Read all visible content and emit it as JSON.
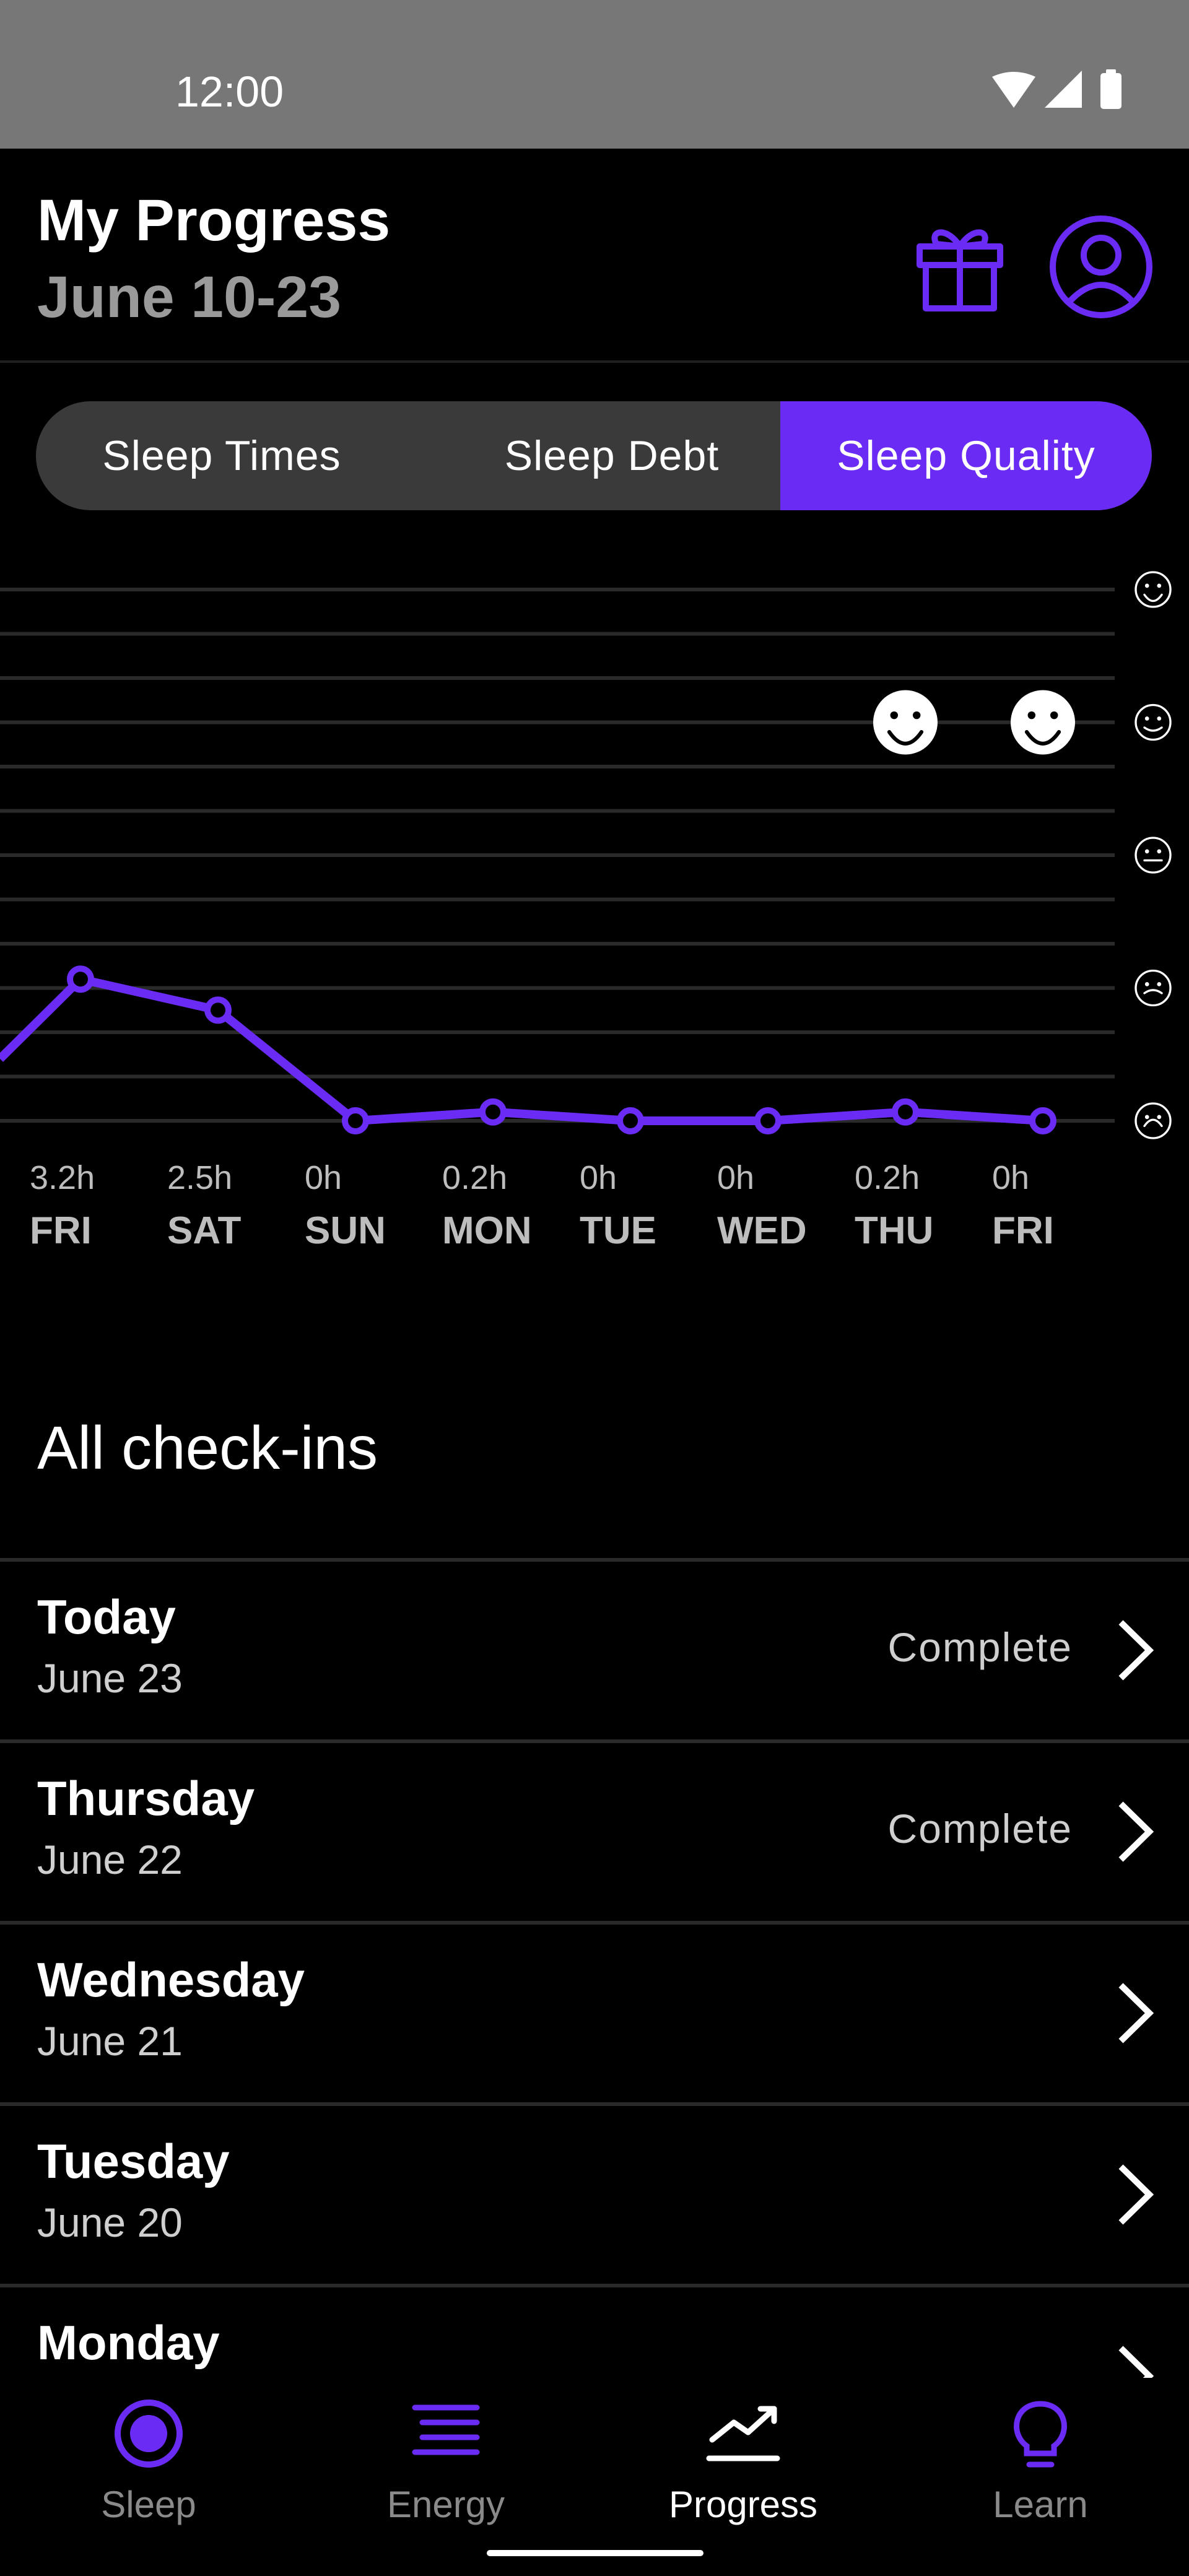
{
  "status": {
    "time": "12:00"
  },
  "header": {
    "title": "My Progress",
    "subtitle": "June 10-23"
  },
  "tabs": [
    {
      "label": "Sleep Times",
      "active": false
    },
    {
      "label": "Sleep Debt",
      "active": false
    },
    {
      "label": "Sleep Quality",
      "active": true
    }
  ],
  "chart_data": {
    "type": "line",
    "categories": [
      "FRI",
      "SAT",
      "SUN",
      "MON",
      "TUE",
      "WED",
      "THU",
      "FRI"
    ],
    "value_labels": [
      "3.2h",
      "2.5h",
      "0h",
      "0.2h",
      "0h",
      "0h",
      "0.2h",
      "0h"
    ],
    "values": [
      3.2,
      2.5,
      0,
      0.2,
      0,
      0,
      0.2,
      0
    ],
    "quality_checkins": [
      {
        "category_index": 6,
        "level": 4
      },
      {
        "category_index": 7,
        "level": 4
      }
    ],
    "quality_levels": [
      "very-unhappy",
      "unhappy",
      "neutral",
      "happy",
      "very-happy"
    ],
    "ylim": [
      0,
      12
    ],
    "grid": true,
    "line_color": "#6a2cf4"
  },
  "checkins": {
    "title": "All check-ins",
    "items": [
      {
        "day": "Today",
        "date": "June 23",
        "status": "Complete"
      },
      {
        "day": "Thursday",
        "date": "June 22",
        "status": "Complete"
      },
      {
        "day": "Wednesday",
        "date": "June 21",
        "status": ""
      },
      {
        "day": "Tuesday",
        "date": "June 20",
        "status": ""
      },
      {
        "day": "Monday",
        "date": "",
        "status": ""
      }
    ]
  },
  "nav": {
    "items": [
      {
        "label": "Sleep",
        "icon": "sleep-icon",
        "active": false
      },
      {
        "label": "Energy",
        "icon": "energy-icon",
        "active": false
      },
      {
        "label": "Progress",
        "icon": "progress-icon",
        "active": true
      },
      {
        "label": "Learn",
        "icon": "learn-icon",
        "active": false
      }
    ]
  },
  "colors": {
    "accent": "#6a2cf4",
    "muted": "#8a8a8a"
  }
}
